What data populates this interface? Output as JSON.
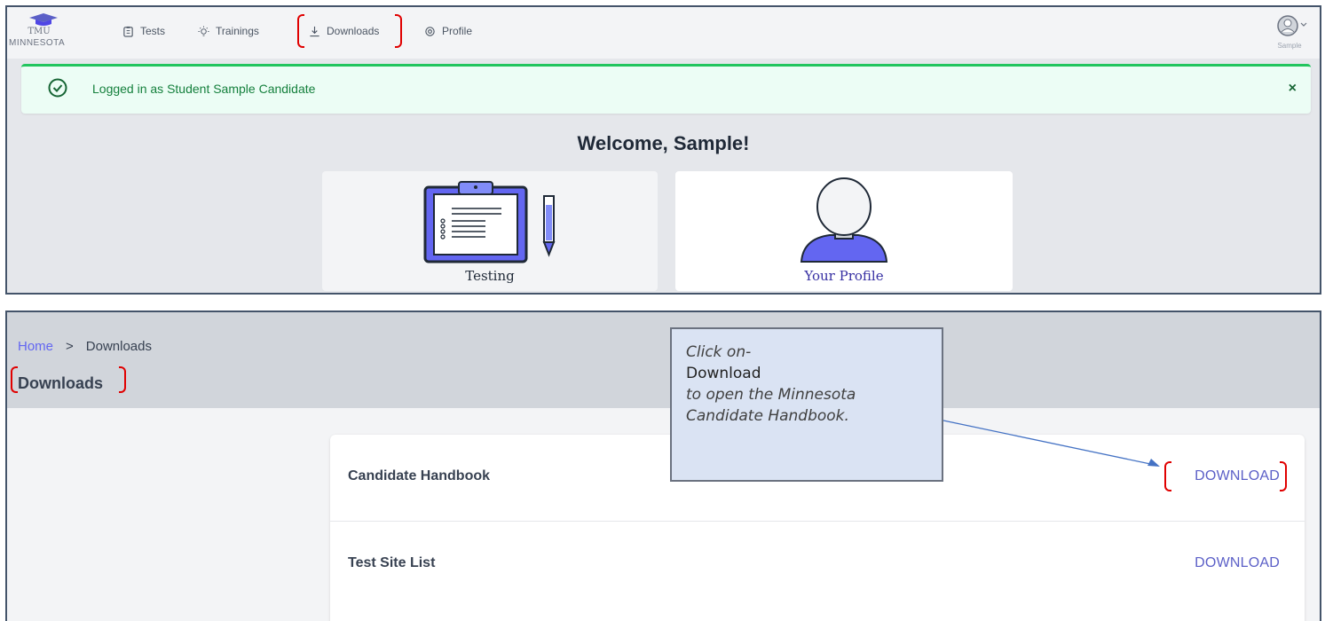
{
  "top": {
    "logo": {
      "line1": "TMU",
      "line2": "MINNESOTA"
    },
    "nav": [
      {
        "label": "Tests",
        "icon": "clipboard-icon"
      },
      {
        "label": "Trainings",
        "icon": "lightbulb-icon"
      },
      {
        "label": "Downloads",
        "icon": "download-icon"
      },
      {
        "label": "Profile",
        "icon": "gear-icon"
      }
    ],
    "user": {
      "label": "Sample",
      "icon": "user-avatar-icon"
    },
    "alert": {
      "text": "Logged in as Student Sample Candidate",
      "close": "×",
      "color": "#22c55e"
    },
    "welcome": "Welcome, Sample!",
    "cards": [
      {
        "label": "Testing",
        "icon": "clipboard-pen-icon",
        "color": "#1f2937"
      },
      {
        "label": "Your Profile",
        "icon": "person-bust-icon",
        "color": "#3730a3"
      }
    ]
  },
  "bottom": {
    "breadcrumb": {
      "home": "Home",
      "separator": ">",
      "current": "Downloads"
    },
    "title": "Downloads",
    "downloads": [
      {
        "name": "Candidate Handbook",
        "button": "DOWNLOAD"
      },
      {
        "name": "Test Site List",
        "button": "DOWNLOAD"
      }
    ],
    "callout": {
      "line1": "Click on-",
      "line2": "Download",
      "line3": "to open the Minnesota",
      "line4": "Candidate Handbook."
    }
  },
  "colors": {
    "accent": "#5b5fc7",
    "highlight": "#e00000",
    "callout_bg": "#dae3f3"
  }
}
